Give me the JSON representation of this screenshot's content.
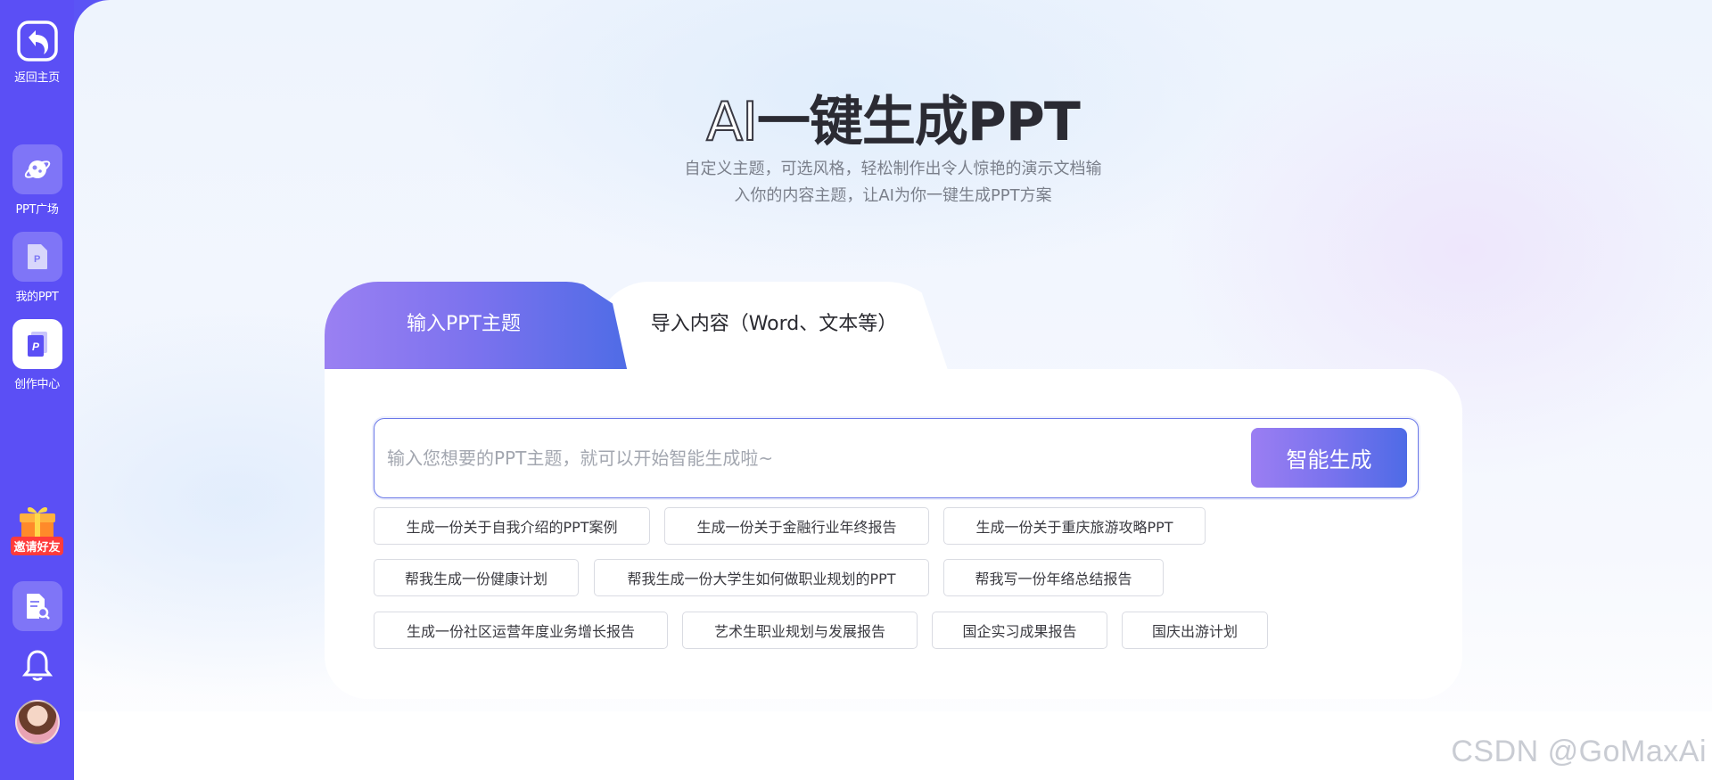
{
  "sidebar": {
    "back_home": "返回主页",
    "ppt_square": "PPT广场",
    "my_ppt": "我的PPT",
    "creation_center": "创作中心",
    "invite": "邀请好友"
  },
  "hero": {
    "title_ai": "AI",
    "title_rest": "一键生成PPT",
    "subtitle_line1": "自定义主题，可选风格，轻松制作出令人惊艳的演示文档输",
    "subtitle_line2": "入你的内容主题，让AI为你一键生成PPT方案"
  },
  "tabs": [
    {
      "label": "输入PPT主题",
      "active": true
    },
    {
      "label": "导入内容（Word、文本等）",
      "active": false
    }
  ],
  "input": {
    "placeholder": "输入您想要的PPT主题，就可以开始智能生成啦~",
    "value": ""
  },
  "generate_button": "智能生成",
  "suggestions": [
    "生成一份关于自我介绍的PPT案例",
    "生成一份关于金融行业年终报告",
    "生成一份关于重庆旅游攻略PPT",
    "帮我生成一份健康计划",
    "帮我生成一份大学生如何做职业规划的PPT",
    "帮我写一份年络总结报告",
    "生成一份社区运营年度业务增长报告",
    "艺术生职业规划与发展报告",
    "国企实习成果报告",
    "国庆出游计划"
  ],
  "watermark": "CSDN @GoMaxAi",
  "colors": {
    "sidebar": "#5b4ff5",
    "accent_start": "#9b7ef2",
    "accent_end": "#4e6be6"
  }
}
